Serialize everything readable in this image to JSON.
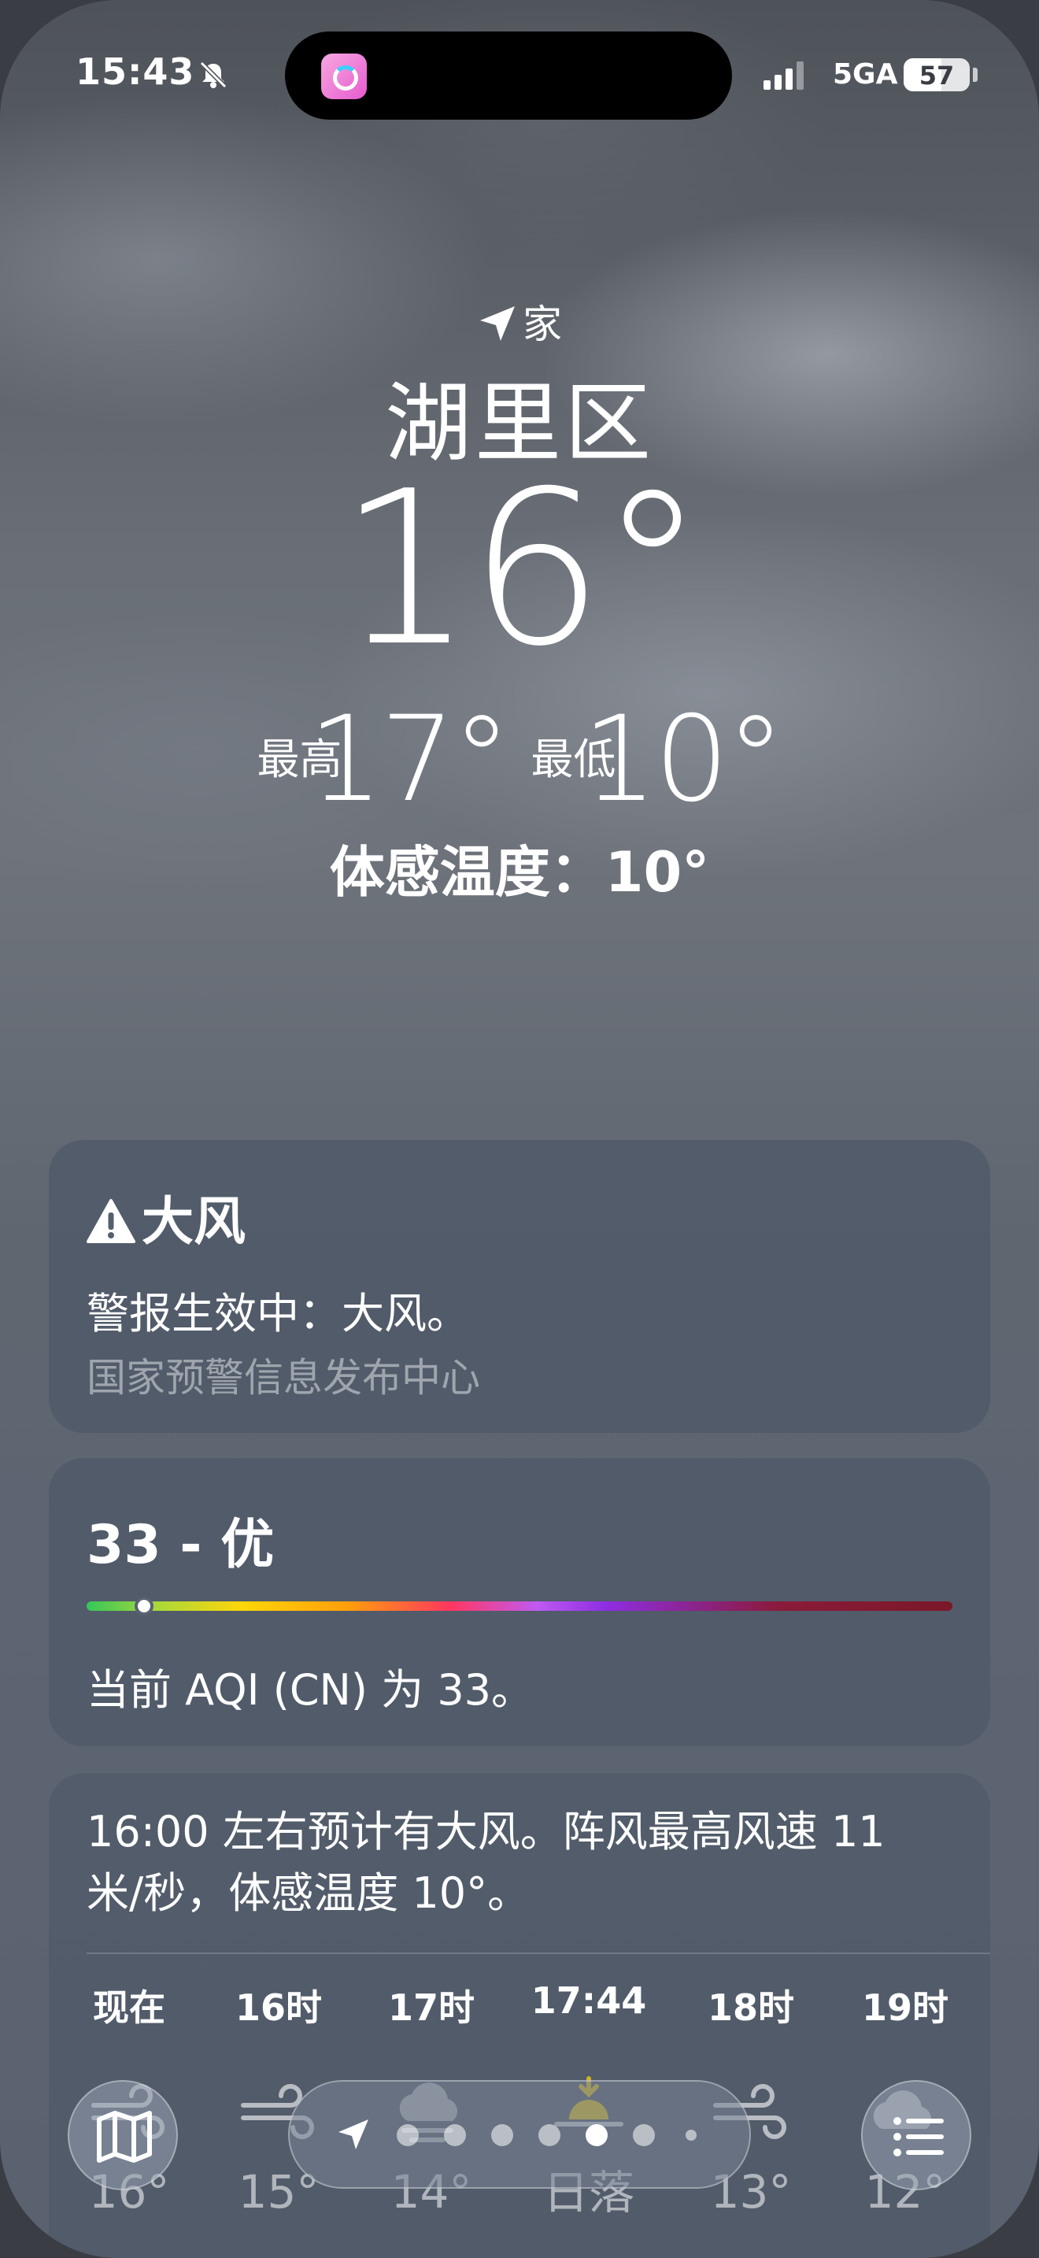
{
  "status_bar": {
    "time": "15:43",
    "network": "5GA",
    "battery": "57",
    "battery_level_percent": 57,
    "icons": [
      "bell-off-icon",
      "signal-icon",
      "battery-icon"
    ]
  },
  "location": {
    "label": "家",
    "city": "湖里区"
  },
  "current": {
    "temp": "16°",
    "high_label": "最高",
    "high": "17°",
    "low_label": "最低",
    "low": "10°",
    "feels_like": "体感温度：10°"
  },
  "alert": {
    "title": "大风",
    "message": "警报生效中：大风。",
    "source": "国家预警信息发布中心",
    "icon": "warning-triangle-icon"
  },
  "aqi": {
    "title": "33 - 优",
    "value": 33,
    "scale_max": 500,
    "description": "当前 AQI (CN) 为 33。"
  },
  "hourly": {
    "summary": "16:00 左右预计有大风。阵风最高风速 11 米/秒，体感温度 10°。",
    "items": [
      {
        "label": "现在",
        "icon": "wind-icon",
        "temp": "16°"
      },
      {
        "label": "16时",
        "icon": "wind-icon",
        "temp": "15°"
      },
      {
        "label": "17时",
        "icon": "cloud-wind-icon",
        "temp": "14°"
      },
      {
        "label": "17:44",
        "icon": "sunset-icon",
        "temp": "日落"
      },
      {
        "label": "18时",
        "icon": "wind-icon",
        "temp": "13°"
      },
      {
        "label": "19时",
        "icon": "cloud-icon",
        "temp": "12°"
      }
    ]
  },
  "toolbar": {
    "left": "map-icon",
    "right": "list-icon",
    "page_count": 7,
    "active_page": 5
  },
  "colors": {
    "aqi_good": "#34c759",
    "card_bg": "#4e5868"
  }
}
